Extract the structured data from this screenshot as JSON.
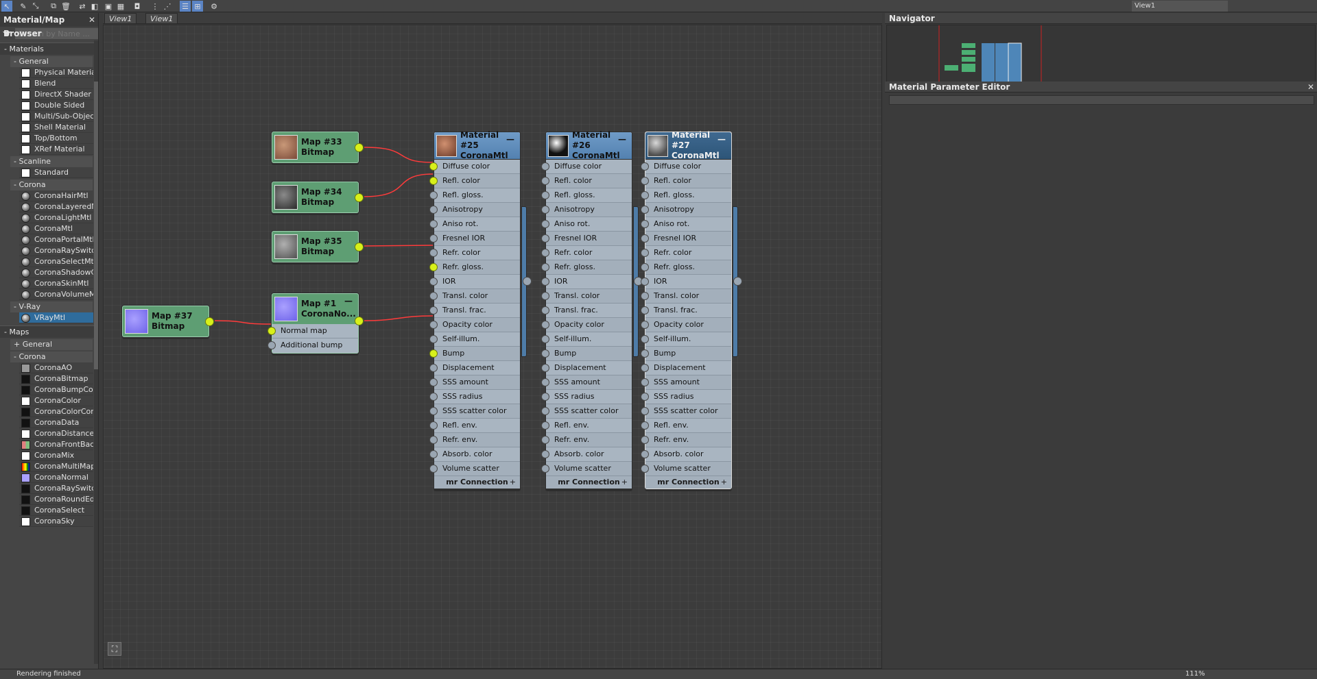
{
  "browser": {
    "title": "Material/Map Browser",
    "search_placeholder": "Search by Name ...",
    "materials_label": "- Materials",
    "general_label": "- General",
    "general_items": [
      "Physical Material",
      "Blend",
      "DirectX Shader",
      "Double Sided",
      "Multi/Sub-Object",
      "Shell Material",
      "Top/Bottom",
      "XRef Material"
    ],
    "scanline_label": "- Scanline",
    "scanline_items": [
      "Standard"
    ],
    "corona_label": "- Corona",
    "corona_items": [
      "CoronaHairMtl",
      "CoronaLayeredMtl",
      "CoronaLightMtl",
      "CoronaMtl",
      "CoronaPortalMtl",
      "CoronaRaySwitchMtl",
      "CoronaSelectMtl",
      "CoronaShadowCatc...",
      "CoronaSkinMtl",
      "CoronaVolumeMtl"
    ],
    "vray_label": "- V-Ray",
    "vray_items": [
      "VRayMtl"
    ],
    "maps_label": "- Maps",
    "maps_general_label": "+ General",
    "maps_corona_label": "- Corona",
    "map_items": [
      "CoronaAO",
      "CoronaBitmap",
      "CoronaBumpConver...",
      "CoronaColor",
      "CoronaColorCorrect",
      "CoronaData",
      "CoronaDistance",
      "CoronaFrontBack",
      "CoronaMix",
      "CoronaMultiMap",
      "CoronaNormal",
      "CoronaRaySwitch",
      "CoronaRoundEdges",
      "CoronaSelect",
      "CoronaSky"
    ]
  },
  "toolbar": {
    "view_selector": "View1"
  },
  "tabs": [
    "View1",
    "View1"
  ],
  "nodes": {
    "map33": {
      "title": "Map #33",
      "type": "Bitmap"
    },
    "map34": {
      "title": "Map #34",
      "type": "Bitmap"
    },
    "map35": {
      "title": "Map #35",
      "type": "Bitmap"
    },
    "map37": {
      "title": "Map #37",
      "type": "Bitmap"
    },
    "map1": {
      "title": "Map #1",
      "type": "CoronaNo...",
      "slots": [
        "Normal map",
        "Additional bump"
      ]
    },
    "mat25": {
      "title": "Material #25",
      "type": "CoronaMtl"
    },
    "mat26": {
      "title": "Material #26",
      "type": "CoronaMtl"
    },
    "mat27": {
      "title": "Material #27",
      "type": "CoronaMtl"
    }
  },
  "material_slots": [
    "Diffuse color",
    "Refl. color",
    "Refl. gloss.",
    "Anisotropy",
    "Aniso rot.",
    "Fresnel IOR",
    "Refr. color",
    "Refr. gloss.",
    "IOR",
    "Transl. color",
    "Transl. frac.",
    "Opacity color",
    "Self-illum.",
    "Bump",
    "Displacement",
    "SSS amount",
    "SSS radius",
    "SSS scatter color",
    "Refl. env.",
    "Refr. env.",
    "Absorb. color",
    "Volume scatter color"
  ],
  "material_footer": "mr Connection",
  "navigator": {
    "title": "Navigator"
  },
  "param_editor": {
    "title": "Material Parameter Editor"
  },
  "status": {
    "text": "Rendering finished",
    "zoom": "111%"
  }
}
